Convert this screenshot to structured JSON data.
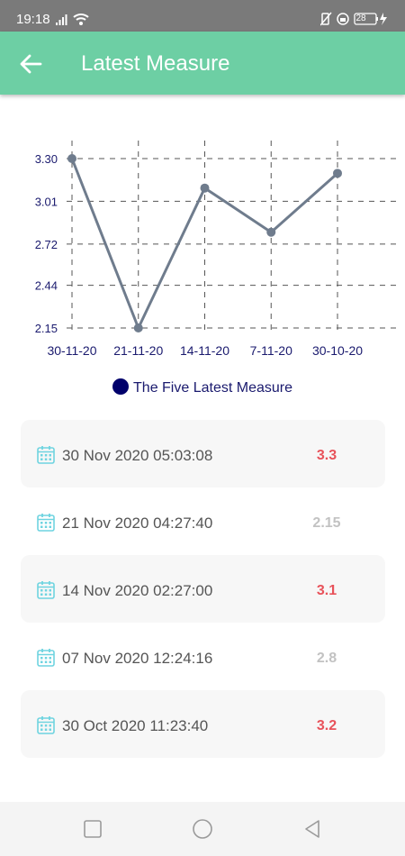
{
  "status_bar": {
    "time": "19:18",
    "battery": "28",
    "text_color": "#ffffff"
  },
  "app_bar": {
    "title": "Latest Measure",
    "color": "#6dcfa4",
    "back_icon": "arrow-left-icon"
  },
  "chart_data": {
    "type": "line",
    "categories": [
      "30-11-20",
      "21-11-20",
      "14-11-20",
      "7-11-20",
      "30-10-20"
    ],
    "series": [
      {
        "name": "The Five Latest Measure",
        "values": [
          3.3,
          2.15,
          3.1,
          2.8,
          3.2
        ]
      }
    ],
    "y_ticks": [
      "3.30",
      "3.01",
      "2.72",
      "2.44",
      "2.15"
    ],
    "ylim": [
      2.15,
      3.3
    ],
    "grid": true,
    "grid_style": "dashed",
    "legend_placement": "bottom",
    "line_color": "#6f7c8d",
    "legend_color": "#00006b"
  },
  "measurements": [
    {
      "date": "30 Nov 2020 05:03:08",
      "value": "3.3",
      "highlight": true
    },
    {
      "date": "21 Nov 2020 04:27:40",
      "value": "2.15",
      "highlight": false
    },
    {
      "date": "14 Nov 2020 02:27:00",
      "value": "3.1",
      "highlight": true
    },
    {
      "date": "07 Nov 2020 12:24:16",
      "value": "2.8",
      "highlight": false
    },
    {
      "date": "30 Oct 2020 11:23:40",
      "value": "3.2",
      "highlight": true
    }
  ],
  "colors": {
    "highlight_value": "#e8525a",
    "muted_value": "#c2c2c2",
    "calendar_icon": "#6fd4e0"
  },
  "nav_bar": {
    "icons": [
      "square-icon",
      "circle-icon",
      "triangle-back-icon"
    ]
  }
}
